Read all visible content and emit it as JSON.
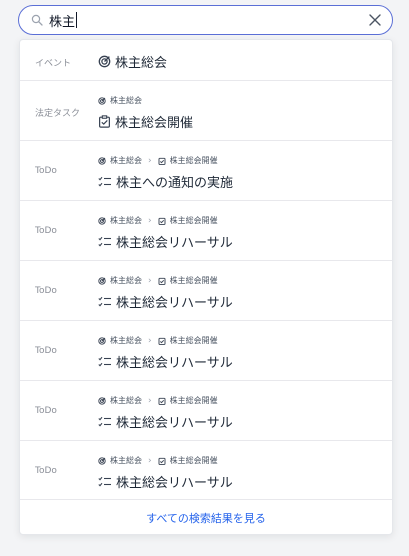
{
  "search": {
    "query": "株主"
  },
  "results": [
    {
      "category": "イベント",
      "title": "株主総会"
    },
    {
      "category": "法定タスク",
      "breadcrumb": [
        "株主総会"
      ],
      "title": "株主総会開催"
    },
    {
      "category": "ToDo",
      "breadcrumb": [
        "株主総会",
        "株主総会開催"
      ],
      "title": "株主への通知の実施"
    },
    {
      "category": "ToDo",
      "breadcrumb": [
        "株主総会",
        "株主総会開催"
      ],
      "title": "株主総会リハーサル"
    },
    {
      "category": "ToDo",
      "breadcrumb": [
        "株主総会",
        "株主総会開催"
      ],
      "title": "株主総会リハーサル"
    },
    {
      "category": "ToDo",
      "breadcrumb": [
        "株主総会",
        "株主総会開催"
      ],
      "title": "株主総会リハーサル"
    },
    {
      "category": "ToDo",
      "breadcrumb": [
        "株主総会",
        "株主総会開催"
      ],
      "title": "株主総会リハーサル"
    },
    {
      "category": "ToDo",
      "breadcrumb": [
        "株主総会",
        "株主総会開催"
      ],
      "title": "株主総会リハーサル"
    }
  ],
  "footer": {
    "see_all_label": "すべての検索結果を見る"
  },
  "colors": {
    "focus_border": "#5b6fd6",
    "link": "#2563eb"
  }
}
